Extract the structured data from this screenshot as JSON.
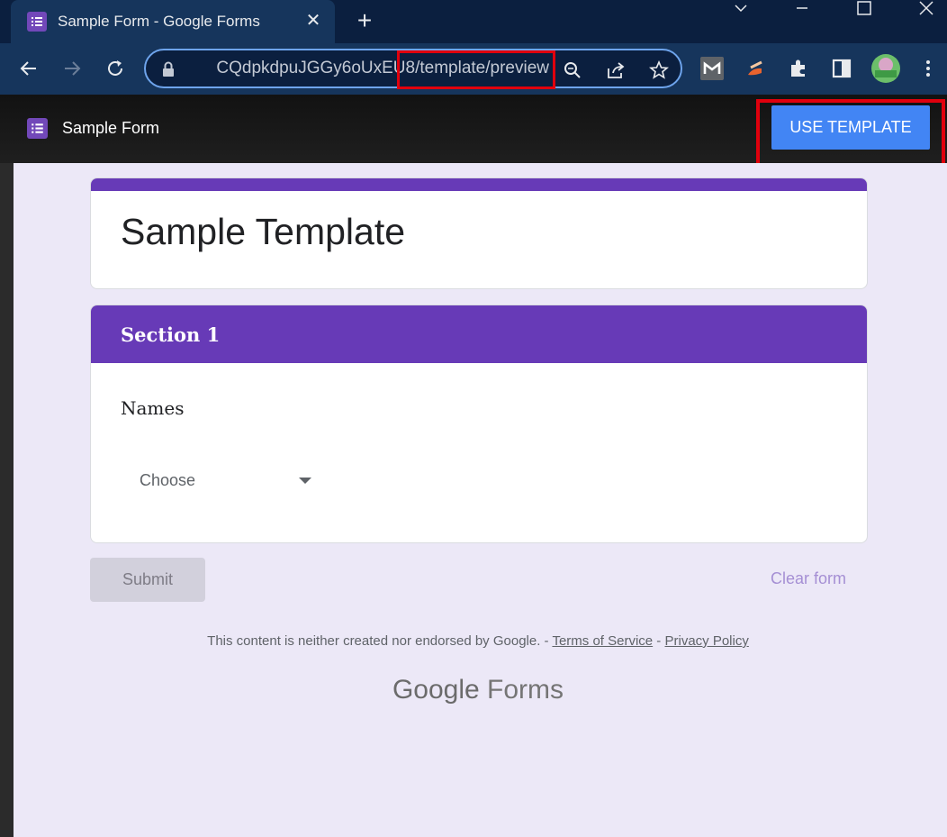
{
  "browser": {
    "tab": {
      "title": "Sample Form - Google Forms",
      "close": "✕"
    },
    "new_tab": "+",
    "window_controls": {
      "dropdown": "⌵",
      "minimize": "—",
      "maximize": "☐",
      "close": "✕"
    },
    "url": "CQdpkdpuJGGy6oUxEU8/template/preview",
    "extensions": [
      "gmail-m-icon",
      "brush-icon",
      "puzzle-icon",
      "sidepanel-icon",
      "avatar"
    ]
  },
  "header": {
    "form_name": "Sample Form",
    "use_template_label": "USE TEMPLATE"
  },
  "form": {
    "title": "Sample Template",
    "section_title": "Section 1",
    "question_label": "Names",
    "dropdown_value": "Choose",
    "submit_label": "Submit",
    "clear_label": "Clear form"
  },
  "footer": {
    "disclaimer": "This content is neither created nor endorsed by Google.",
    "separator1": " - ",
    "terms": "Terms of Service",
    "separator2": " - ",
    "privacy": "Privacy Policy",
    "logo_google": "Google",
    "logo_forms": "Forms"
  },
  "colors": {
    "accent": "#673ab7",
    "button_blue": "#4285f4",
    "highlight": "#e0000d"
  }
}
